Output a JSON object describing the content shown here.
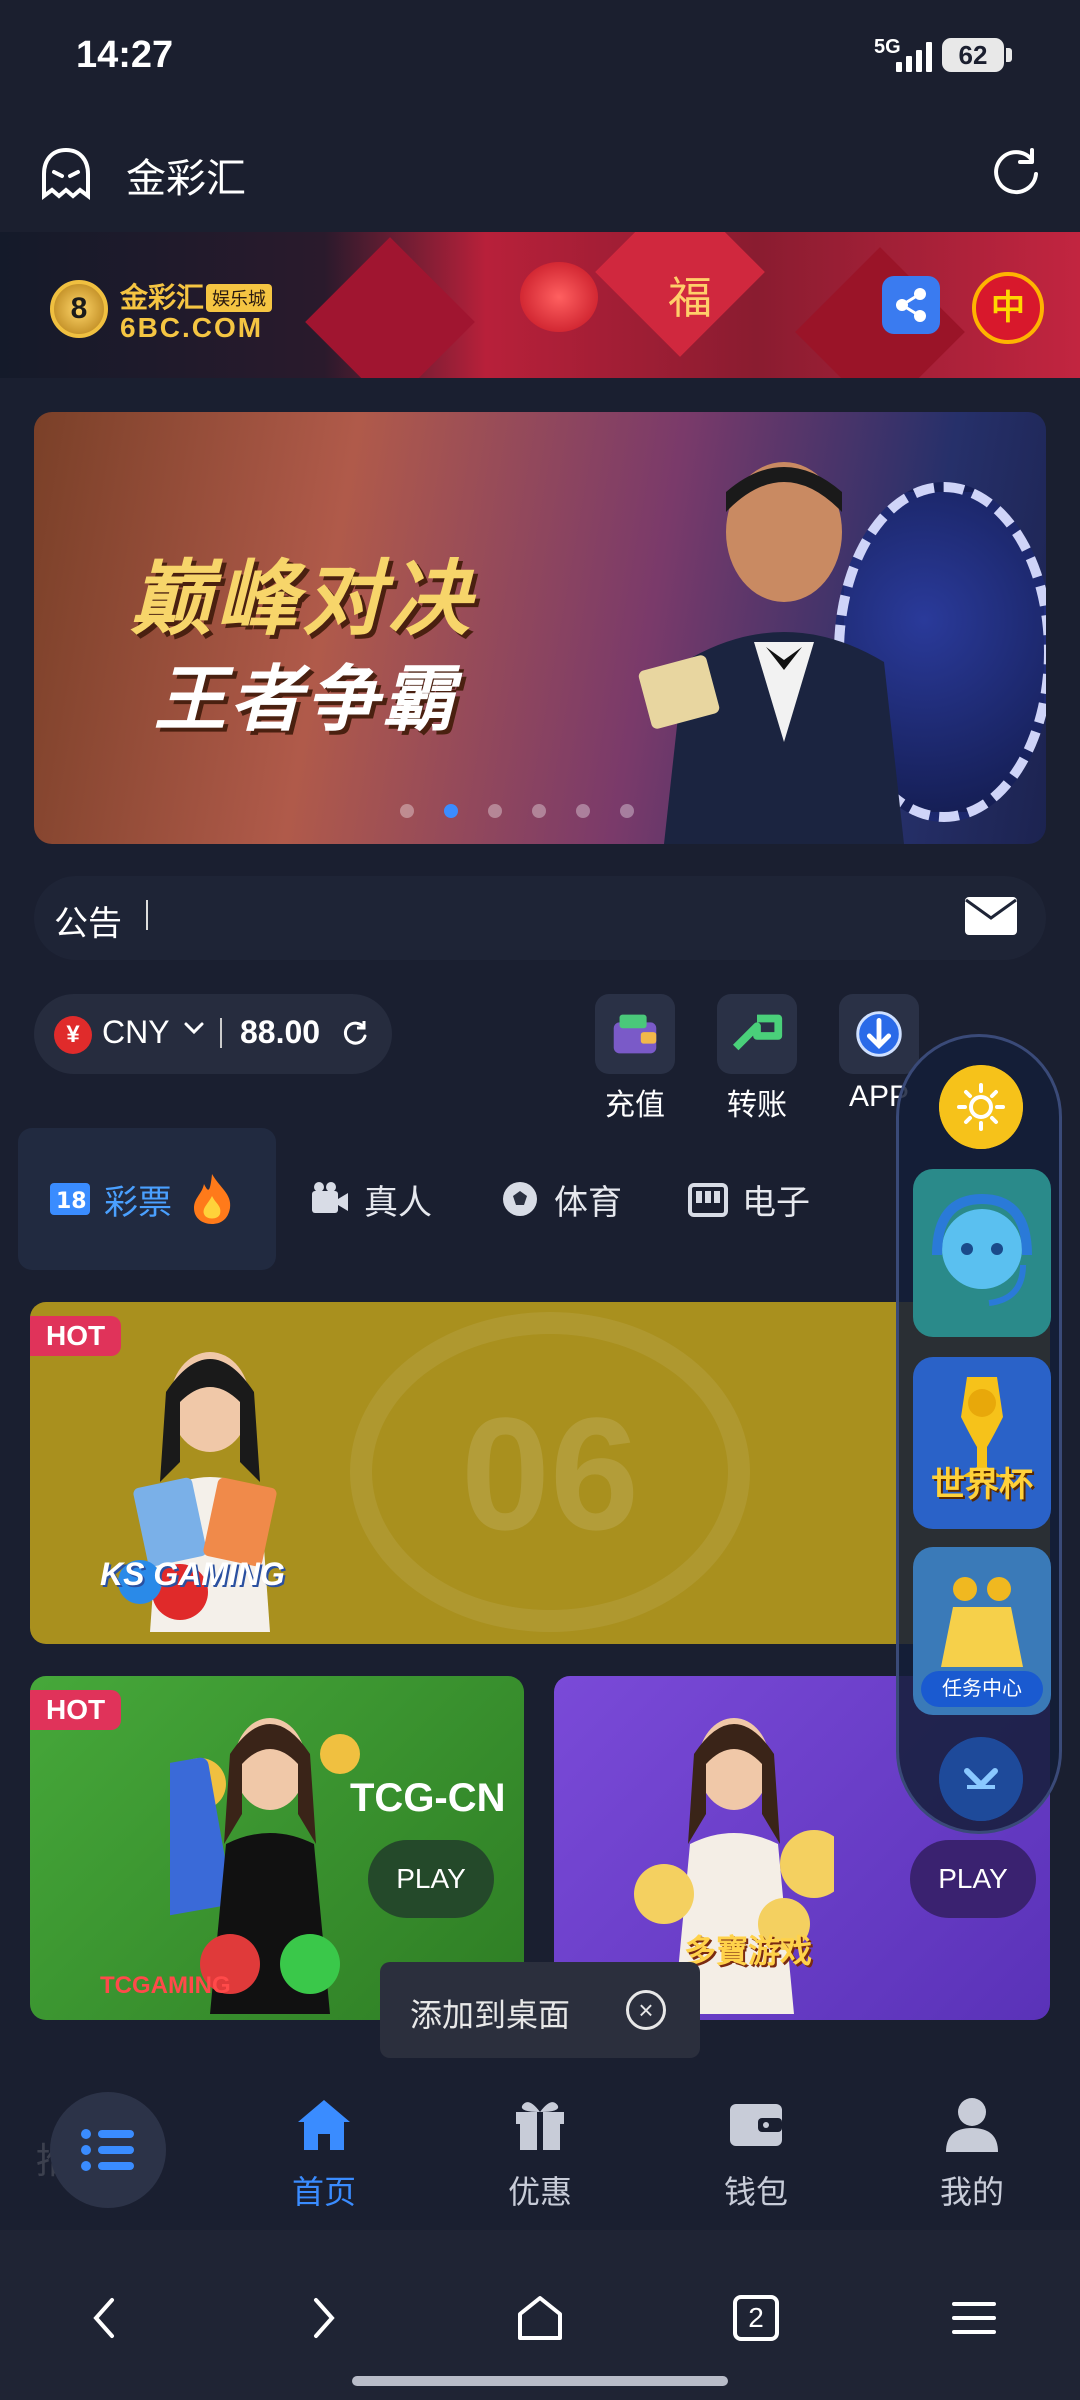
{
  "status": {
    "time": "14:27",
    "network": "5G",
    "battery": "62"
  },
  "app": {
    "title": "金彩汇"
  },
  "site": {
    "brand": "金彩汇",
    "brand_tag": "娱乐城",
    "domain": "6BC.COM",
    "logo_digit": "8",
    "banner_char": "福",
    "language": "中"
  },
  "promo": {
    "line1": "巅峰对决",
    "line2": "王者争霸",
    "slides": 6,
    "active_slide": 1
  },
  "notice": {
    "label": "公告"
  },
  "wallet": {
    "currency_symbol": "¥",
    "currency": "CNY",
    "balance": "88.00"
  },
  "quick_actions": [
    {
      "label": "充值",
      "icon": "deposit-icon"
    },
    {
      "label": "转账",
      "icon": "transfer-icon"
    },
    {
      "label": "APP",
      "icon": "download-icon"
    }
  ],
  "tabs": [
    {
      "label": "彩票",
      "icon": "lottery-18-icon",
      "active": true
    },
    {
      "label": "真人",
      "icon": "video-camera-icon"
    },
    {
      "label": "体育",
      "icon": "soccer-ball-icon"
    },
    {
      "label": "电子",
      "icon": "slot-machine-icon"
    }
  ],
  "games": {
    "ks": {
      "badge": "HOT",
      "name": "KS GAMING",
      "watermark": "06"
    },
    "tcg": {
      "badge": "HOT",
      "name": "TCG-CN",
      "play": "PLAY",
      "logo": "TCGAMING"
    },
    "db": {
      "play": "PLAY",
      "logo": "多寶游戏"
    }
  },
  "side_panel": {
    "worldcup": "世界杯",
    "tasks": "任务中心"
  },
  "toast": {
    "text": "添加到桌面"
  },
  "bottom_nav": {
    "hint": "推荐",
    "items": [
      {
        "label": "首页",
        "icon": "home-icon",
        "active": true
      },
      {
        "label": "优惠",
        "icon": "gift-icon"
      },
      {
        "label": "钱包",
        "icon": "wallet-icon"
      },
      {
        "label": "我的",
        "icon": "user-icon"
      }
    ]
  },
  "system_nav": {
    "tabs_count": "2"
  },
  "colors": {
    "accent": "#3a8cff",
    "background": "#1a1f30",
    "hot": "#e0335a"
  }
}
